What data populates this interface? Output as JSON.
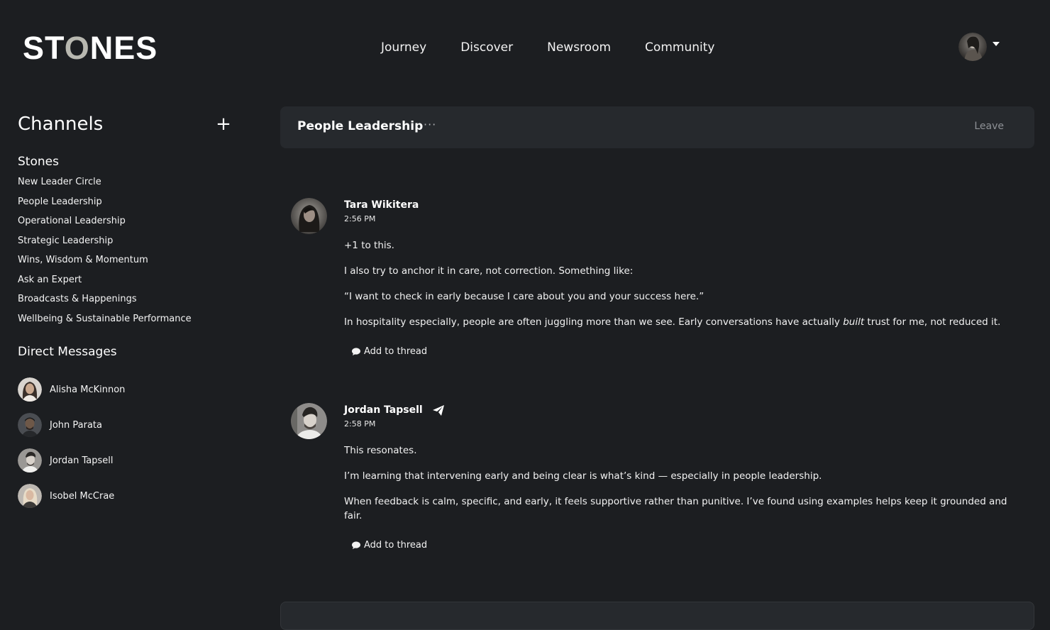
{
  "brand": {
    "logo_prefix": "ST",
    "logo_o": "O",
    "logo_suffix": "NES"
  },
  "nav": {
    "items": [
      "Journey",
      "Discover",
      "Newsroom",
      "Community"
    ]
  },
  "profile": {
    "icon": "user-avatar"
  },
  "sidebar": {
    "channels_title": "Channels",
    "add_icon": "+",
    "section_title": "Stones",
    "channels": [
      "New Leader Circle",
      "People Leadership",
      "Operational Leadership",
      "Strategic Leadership",
      "Wins, Wisdom & Momentum",
      "Ask an Expert",
      "Broadcasts & Happenings",
      "Wellbeing & Sustainable Performance"
    ],
    "dm_title": "Direct Messages",
    "dms": [
      "Alisha McKinnon",
      "John Parata",
      "Jordan Tapsell",
      "Isobel McCrae"
    ]
  },
  "channel_header": {
    "title": "People Leadership",
    "more": "···",
    "leave_label": "Leave"
  },
  "messages": [
    {
      "author": "Tara Wikitera",
      "time": "2:56 PM",
      "lines": {
        "p1": "+1 to this.",
        "p2": "I also try to anchor it in care, not correction. Something like:",
        "p3": "“I want to check in early because I care about you and your success here.”",
        "p4_a": "In hospitality especially, people are often juggling more than we see. Early conversations have actually ",
        "p4_em": "built",
        "p4_b": " trust for me, not reduced it."
      },
      "thread_label": "Add to thread"
    },
    {
      "author": "Jordan Tapsell",
      "time": "2:58 PM",
      "lines": {
        "p1": "This resonates.",
        "p2": "I’m learning that intervening early and being clear is what’s kind — especially in people leadership.",
        "p3": "When feedback is calm, specific, and early, it feels supportive rather than punitive. I’ve found using examples helps keep it grounded and fair."
      },
      "thread_label": "Add to thread"
    }
  ]
}
